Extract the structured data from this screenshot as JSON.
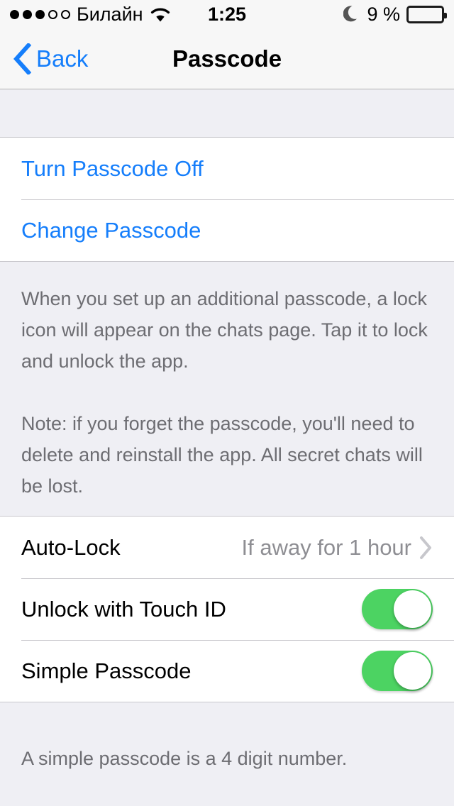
{
  "status_bar": {
    "signal_dots_filled": 3,
    "signal_dots_total": 5,
    "carrier": "Билайн",
    "wifi_icon": "wifi-icon",
    "time": "1:25",
    "moon_icon": "moon-icon",
    "battery_percent": "9 %",
    "battery_level": 15,
    "battery_color": "#EE2B2B"
  },
  "nav_bar": {
    "back_icon": "chevron-left-icon",
    "back_label": "Back",
    "title": "Passcode",
    "tint_color": "#157EFB"
  },
  "groups": [
    {
      "rows": [
        {
          "label": "Turn Passcode Off",
          "type": "link"
        },
        {
          "label": "Change Passcode",
          "type": "link"
        }
      ],
      "footer": [
        "When you set up an additional passcode, a lock icon will appear on the chats page. Tap it to lock and unlock the app.",
        "Note: if you forget the passcode, you'll need to delete and reinstall the app. All secret chats will be lost."
      ]
    },
    {
      "rows": [
        {
          "label": "Auto-Lock",
          "type": "disclosure",
          "value": "If away for 1 hour",
          "chevron_icon": "chevron-right-icon"
        },
        {
          "label": "Unlock with Touch ID",
          "type": "toggle",
          "value": "on"
        },
        {
          "label": "Simple Passcode",
          "type": "toggle",
          "value": "on"
        }
      ],
      "footer": [
        "A simple passcode is a 4 digit number."
      ]
    }
  ],
  "colors": {
    "background": "#EFEFF4",
    "cell": "#FFFFFF",
    "separator": "#C8C7CC",
    "tint": "#157EFB",
    "toggle_on": "#4CD362",
    "secondary_text": "#8E8E93",
    "footer_text": "#6D6D72"
  }
}
